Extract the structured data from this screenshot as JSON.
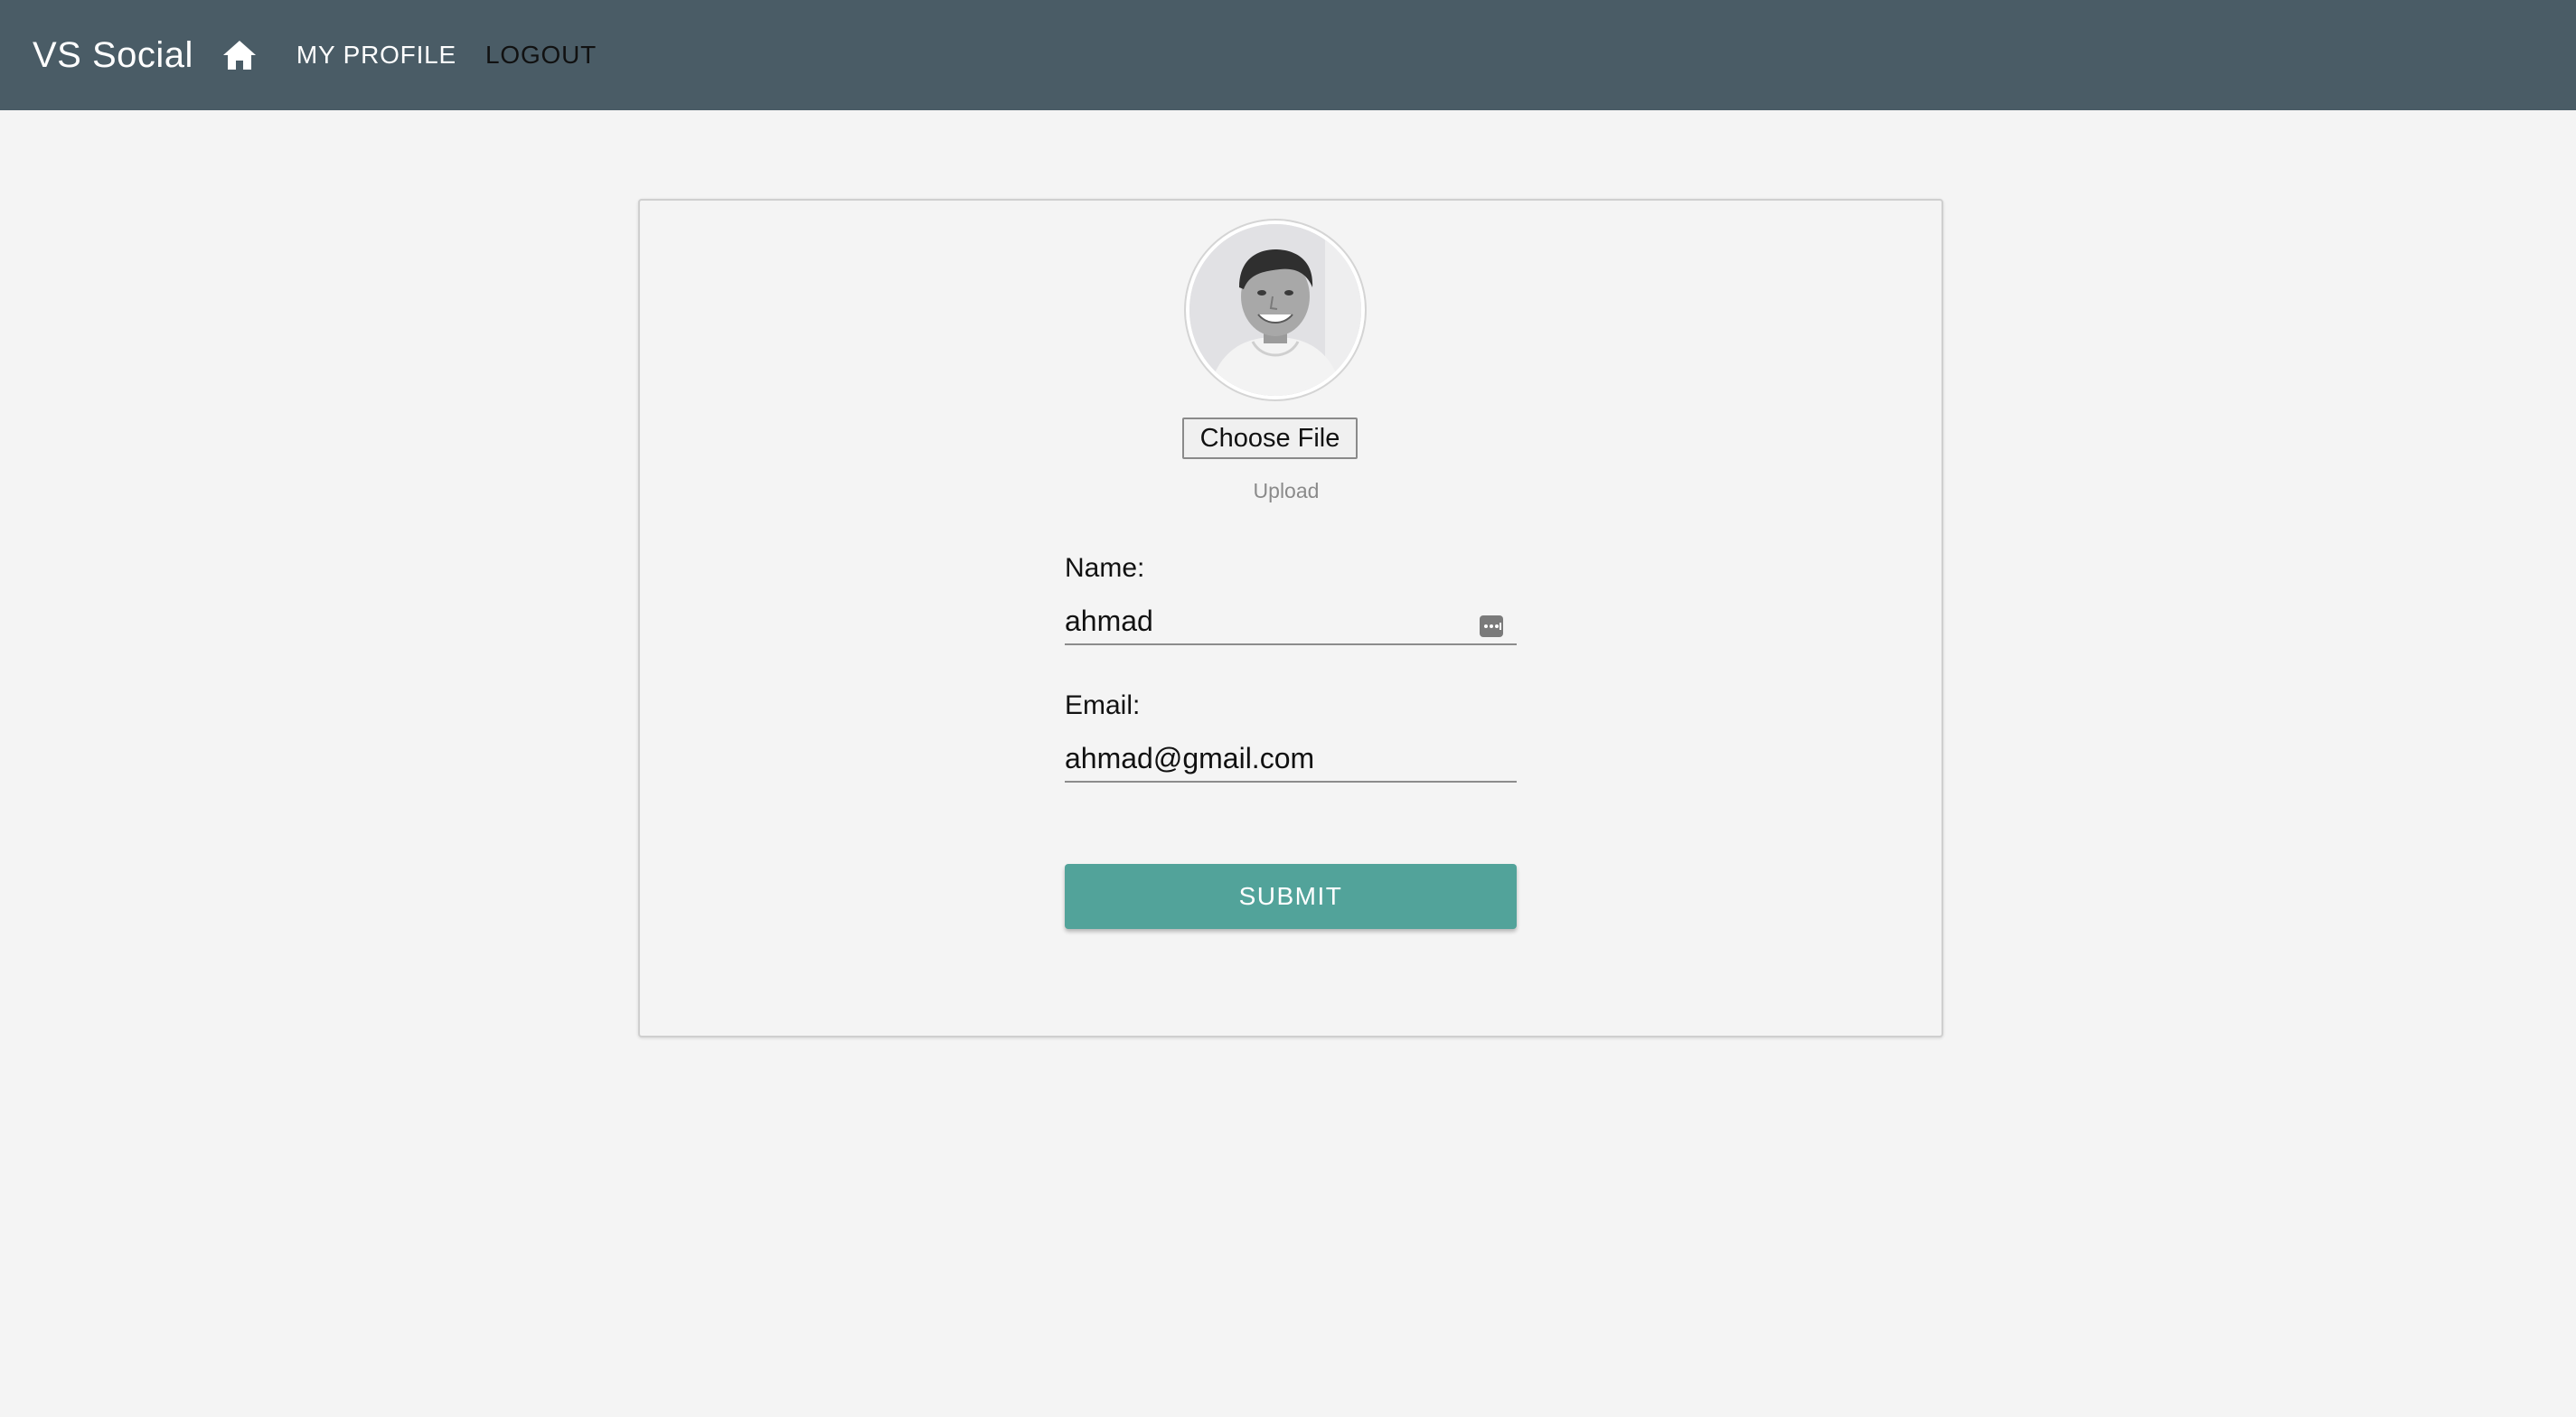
{
  "navbar": {
    "brand": "VS Social",
    "home_icon": "home-icon",
    "links": {
      "my_profile": "MY PROFILE",
      "logout": "LOGOUT"
    },
    "background_color": "#4a5c66"
  },
  "profile_form": {
    "avatar_icon": "profile-photo",
    "file_button_label": "Choose File",
    "upload_label": "Upload",
    "name": {
      "label": "Name:",
      "value": "ahmad",
      "icon": "keyboard-icon"
    },
    "email": {
      "label": "Email:",
      "value": "ahmad@gmail.com"
    },
    "submit_label": "SUBMIT",
    "submit_color": "#52a39a"
  }
}
